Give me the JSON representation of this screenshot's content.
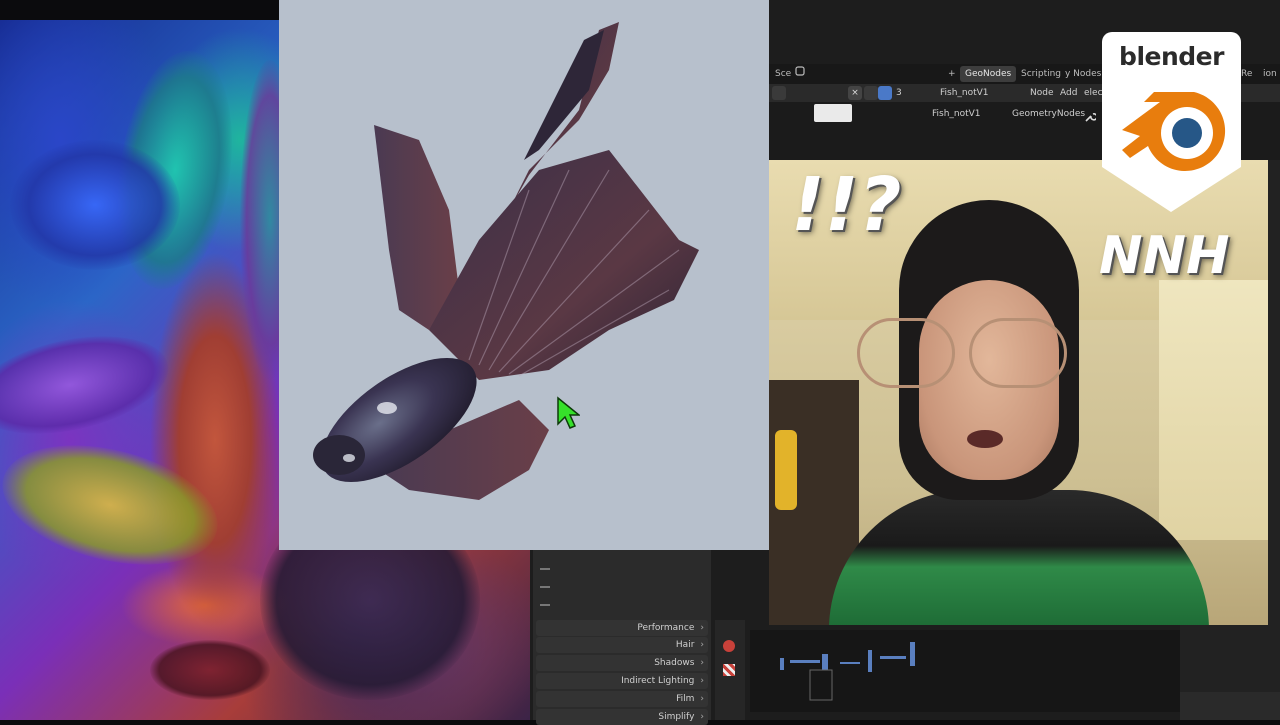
{
  "overlay": {
    "exclaim_text": "!!?",
    "initials_text": "NNH",
    "logo_text": "blender"
  },
  "blender_ui": {
    "tabs": [
      {
        "label": "+",
        "active": false
      },
      {
        "label": "GeoNodes",
        "active": true
      },
      {
        "label": "Scripting",
        "active": false
      },
      {
        "label": "y Nodes",
        "active": false
      },
      {
        "label": "Re",
        "active": false
      },
      {
        "label": "ion",
        "active": false
      }
    ],
    "scene_label": "Sce",
    "header_menus": [
      "elect",
      "Add",
      "Node"
    ],
    "object_name": "Fish_notV1",
    "user_count": "3",
    "breadcrumb": [
      "GeometryNodes",
      "Fish_notV1"
    ],
    "properties_sections": [
      {
        "label": "Performance"
      },
      {
        "label": "Hair"
      },
      {
        "label": "Shadows"
      },
      {
        "label": "Indirect Lighting"
      },
      {
        "label": "Film"
      },
      {
        "label": "Simplify"
      }
    ]
  },
  "colors": {
    "fish_background": "#b7c0cc",
    "cursor_green": "#36e02a",
    "logo_orange": "#e87d0d",
    "logo_blue": "#265787",
    "ui_dark": "#1d1d1d"
  },
  "icons": [
    "cursor-arrow-icon",
    "blender-logo-icon",
    "wrench-icon",
    "scene-icon",
    "expand-chevron-icon"
  ]
}
